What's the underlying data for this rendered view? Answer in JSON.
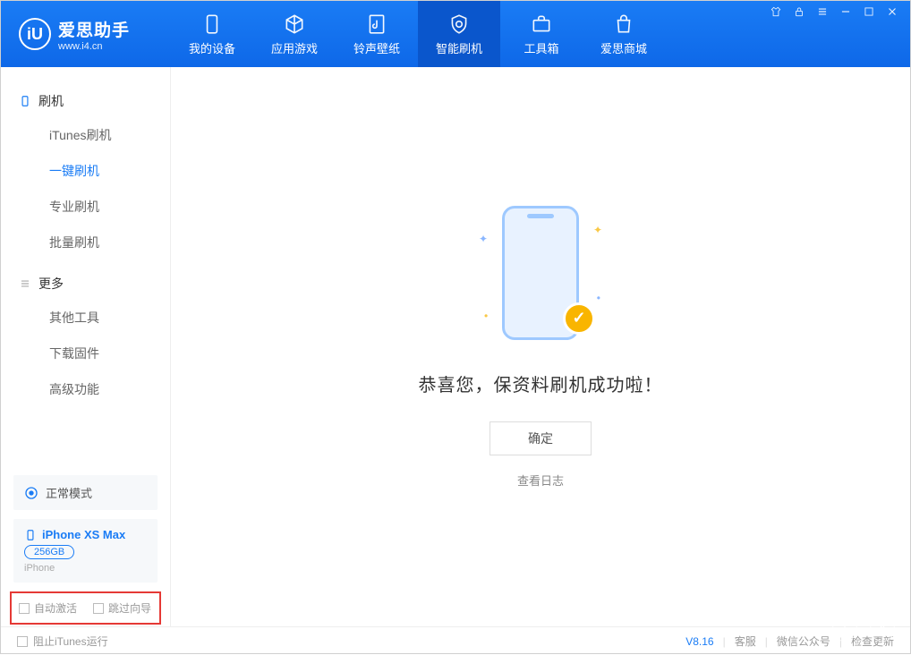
{
  "app": {
    "name": "爱思助手",
    "url": "www.i4.cn"
  },
  "tabs": [
    {
      "label": "我的设备"
    },
    {
      "label": "应用游戏"
    },
    {
      "label": "铃声壁纸"
    },
    {
      "label": "智能刷机"
    },
    {
      "label": "工具箱"
    },
    {
      "label": "爱思商城"
    }
  ],
  "sidebar": {
    "group1_title": "刷机",
    "group1_items": [
      "iTunes刷机",
      "一键刷机",
      "专业刷机",
      "批量刷机"
    ],
    "group2_title": "更多",
    "group2_items": [
      "其他工具",
      "下载固件",
      "高级功能"
    ]
  },
  "mode": "正常模式",
  "device": {
    "name": "iPhone XS Max",
    "capacity": "256GB",
    "type": "iPhone"
  },
  "options": {
    "auto_activate": "自动激活",
    "skip_guide": "跳过向导"
  },
  "main": {
    "success_text": "恭喜您，保资料刷机成功啦！",
    "ok_button": "确定",
    "view_log": "查看日志"
  },
  "footer": {
    "block_itunes": "阻止iTunes运行",
    "version": "V8.16",
    "support": "客服",
    "wechat": "微信公众号",
    "update": "检查更新"
  }
}
